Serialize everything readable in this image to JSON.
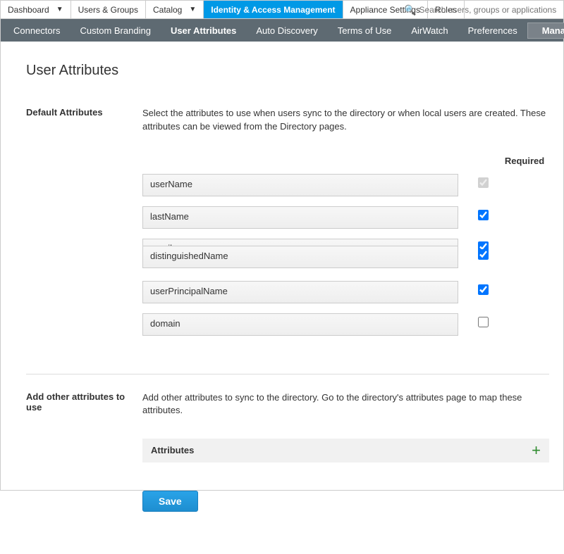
{
  "topnav": {
    "tabs": [
      {
        "label": "Dashboard",
        "hasChevron": true
      },
      {
        "label": "Users & Groups"
      },
      {
        "label": "Catalog",
        "hasChevron": true
      },
      {
        "label": "Identity & Access Management",
        "active": true
      },
      {
        "label": "Appliance Settings"
      },
      {
        "label": "Roles"
      }
    ],
    "search_placeholder": "Search users, groups or applications"
  },
  "subnav": {
    "items": [
      "Connectors",
      "Custom Branding",
      "User Attributes",
      "Auto Discovery",
      "Terms of Use",
      "AirWatch",
      "Preferences"
    ],
    "active_index": 2,
    "manage_label": "Manage"
  },
  "page_title": "User Attributes",
  "default_attrs": {
    "heading": "Default Attributes",
    "desc": "Select the attributes to use when users sync to the directory or when local users are created. These attributes can be viewed from the Directory pages.",
    "required_header": "Required",
    "rows": [
      {
        "name": "userName",
        "required": true,
        "disabled": true
      },
      {
        "name": "lastName",
        "required": true,
        "disabled": false
      },
      {
        "name": "email",
        "required": true,
        "disabled": false
      },
      {
        "name": "distinguishedName",
        "required": true,
        "disabled": false
      },
      {
        "name": "userPrincipalName",
        "required": true,
        "disabled": false
      },
      {
        "name": "domain",
        "required": false,
        "disabled": false
      }
    ]
  },
  "other_attrs": {
    "heading": "Add other attributes to use",
    "desc": "Add other attributes to sync to the directory. Go to the directory's attributes page to map these attributes.",
    "bar_label": "Attributes"
  },
  "save_label": "Save"
}
